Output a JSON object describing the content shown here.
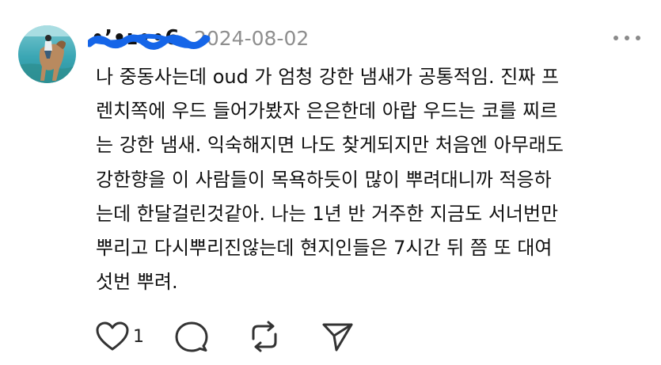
{
  "post": {
    "username": "•ʼ•ʟ••6",
    "date": "2024-08-02",
    "body_lines": [
      "나 중동사는데 oud 가 엄청 강한 냄새가 공통적임. 진짜 프",
      "렌치쪽에 우드 들어가봤자 은은한데 아랍 우드는 코를 찌르",
      "는 강한 냄새. 익숙해지면 나도 찾게되지만 처음엔 아무래도",
      "강한향을 이 사람들이 목욕하듯이 많이 뿌려대니까 적응하",
      "는데 한달걸린것같아. 나는 1년 반 거주한 지금도 서너번만",
      "뿌리고 다시뿌리진않는데 현지인들은 7시간 뒤 쯤 또 대여",
      "섯번 뿌려."
    ],
    "like_count": "1"
  },
  "icons": {
    "more": "more-options-icon",
    "like": "heart-icon",
    "reply": "comment-bubble-icon",
    "repost": "repost-icon",
    "share": "send-icon"
  },
  "colors": {
    "text": "#111111",
    "date": "#8e8e8e",
    "redaction": "#1565e8"
  }
}
